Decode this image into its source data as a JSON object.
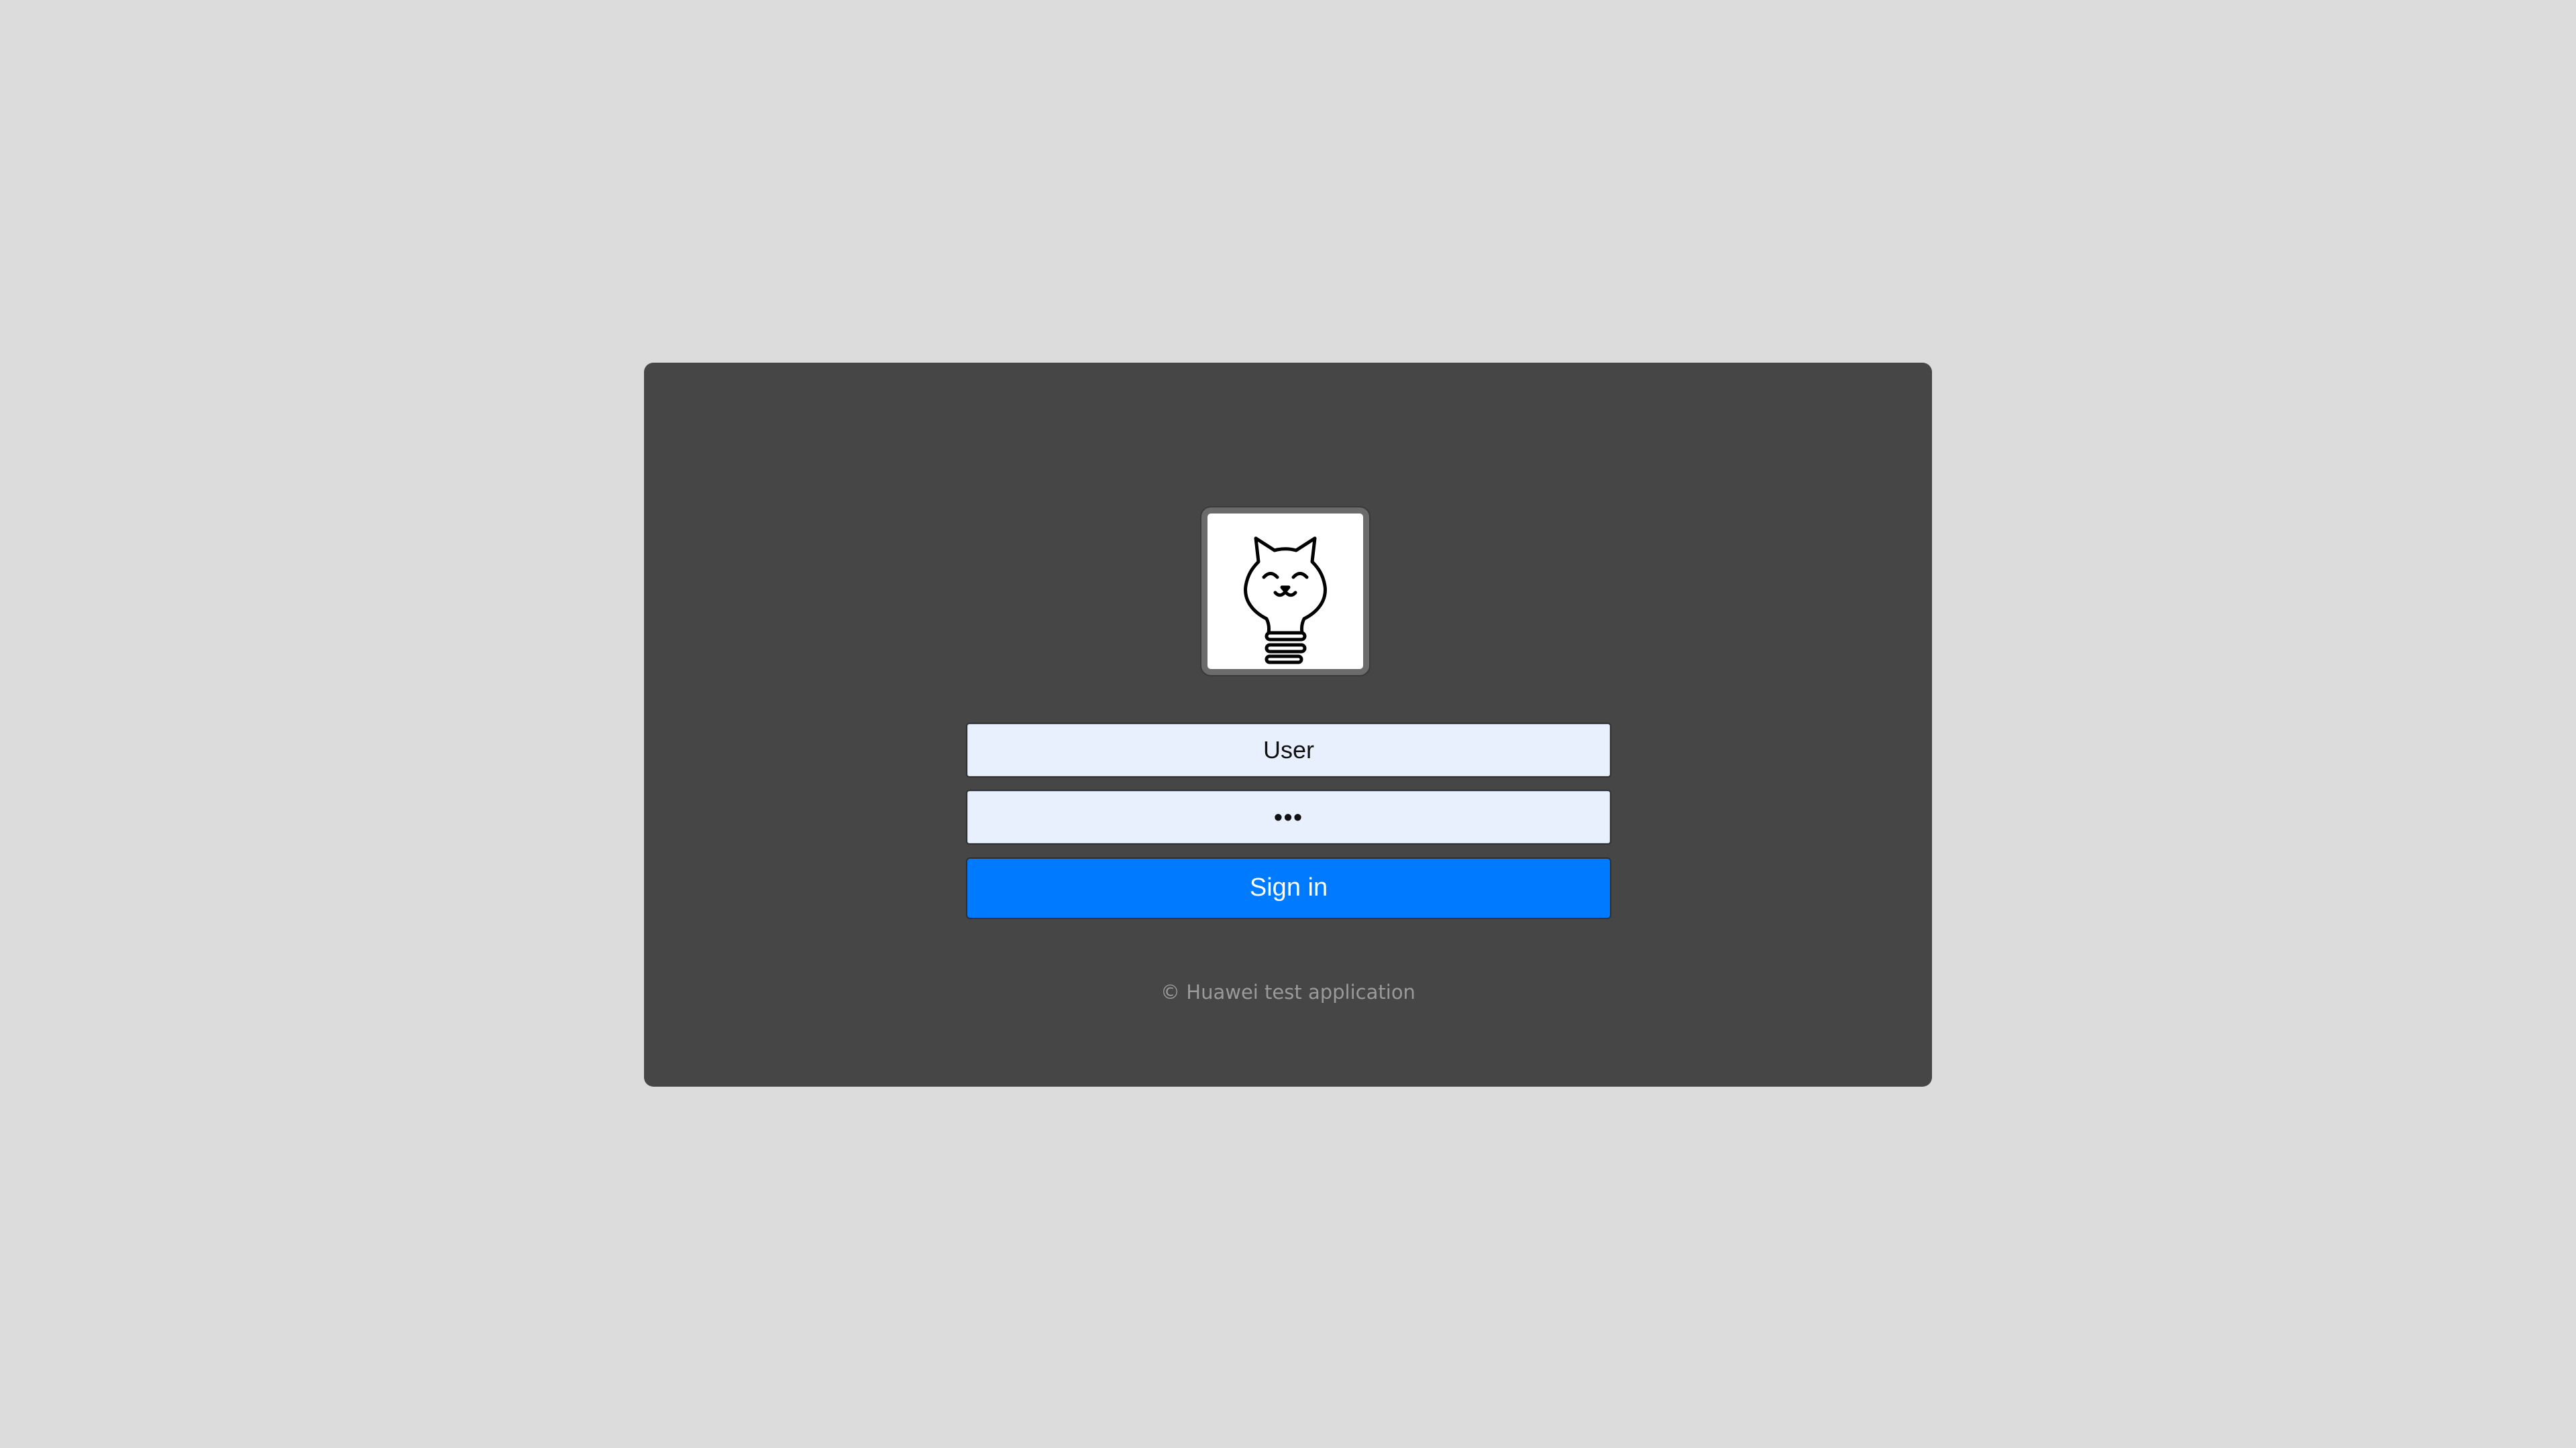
{
  "login": {
    "logo_icon": "cat-lightbulb-icon",
    "username_value": "User",
    "password_value": "•••",
    "signin_label": "Sign in",
    "footer_text": "© Huawei test application"
  },
  "colors": {
    "page_background": "#dcdcdc",
    "panel_background": "#464646",
    "input_background": "#e8f0fe",
    "button_primary": "#007bff",
    "footer_text": "#9a9a9a"
  }
}
